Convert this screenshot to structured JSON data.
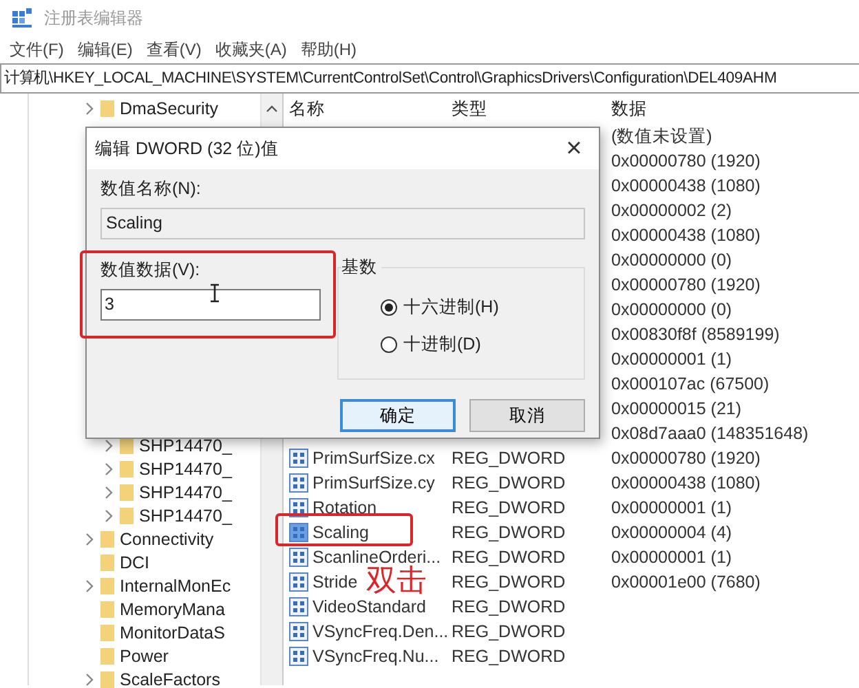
{
  "window": {
    "title": "注册表编辑器"
  },
  "menu": [
    "文件(F)",
    "编辑(E)",
    "查看(V)",
    "收藏夹(A)",
    "帮助(H)"
  ],
  "address": "计算机\\HKEY_LOCAL_MACHINE\\SYSTEM\\CurrentControlSet\\Control\\GraphicsDrivers\\Configuration\\DEL409AHM",
  "tree": {
    "items": [
      {
        "label": "DmaSecurity",
        "expandable": true
      },
      {
        "children": [
          {
            "label": "SHP14470_",
            "expandable": true
          },
          {
            "label": "SHP14470_",
            "expandable": true
          },
          {
            "label": "SHP14470_",
            "expandable": true
          },
          {
            "label": "SHP14470_",
            "expandable": true
          }
        ]
      },
      {
        "label": "Connectivity",
        "expandable": true
      },
      {
        "label": "DCI",
        "expandable": false
      },
      {
        "label": "InternalMonEc",
        "expandable": true
      },
      {
        "label": "MemoryMana",
        "expandable": false
      },
      {
        "label": "MonitorDataS",
        "expandable": false
      },
      {
        "label": "Power",
        "expandable": false
      },
      {
        "label": "ScaleFactors",
        "expandable": true
      }
    ]
  },
  "list": {
    "columns": [
      "名称",
      "类型",
      "数据"
    ],
    "rows": [
      {
        "data": "(数值未设置)"
      },
      {
        "data": "0x00000780 (1920)"
      },
      {
        "data": "0x00000438 (1080)"
      },
      {
        "data": "0x00000002 (2)"
      },
      {
        "data": "0x00000438 (1080)"
      },
      {
        "data": "0x00000000 (0)"
      },
      {
        "data": "0x00000780 (1920)"
      },
      {
        "data": "0x00000000 (0)"
      },
      {
        "data": "0x00830f8f (8589199)"
      },
      {
        "data": "0x00000001 (1)"
      },
      {
        "data": "0x000107ac (67500)"
      },
      {
        "data": "0x00000015 (21)"
      },
      {
        "data": "0x08d7aaa0 (148351648)"
      },
      {
        "name": "PrimSurfSize.cx",
        "type": "REG_DWORD",
        "data": "0x00000780 (1920)"
      },
      {
        "name": "PrimSurfSize.cy",
        "type": "REG_DWORD",
        "data": "0x00000438 (1080)"
      },
      {
        "name": "Rotation",
        "type": "REG_DWORD",
        "data": "0x00000001 (1)"
      },
      {
        "name": "Scaling",
        "type": "REG_DWORD",
        "data": "0x00000004 (4)",
        "marked": true
      },
      {
        "name": "ScanlineOrderi...",
        "type": "REG_DWORD",
        "data": "0x00000001 (1)"
      },
      {
        "name": "Stride",
        "type": "REG_DWORD",
        "data": "0x00001e00 (7680)"
      },
      {
        "name": "VideoStandard",
        "type": "REG_DWORD"
      },
      {
        "name": "VSyncFreq.Den...",
        "type": "REG_DWORD"
      },
      {
        "name": "VSyncFreq.Nu...",
        "type": "REG_DWORD"
      }
    ]
  },
  "dialog": {
    "title": "编辑 DWORD (32 位)值",
    "close": "×",
    "name_label": "数值名称(N):",
    "name_value": "Scaling",
    "data_label": "数值数据(V):",
    "data_value": "3",
    "base_label": "基数",
    "radios": [
      {
        "label": "十六进制(H)",
        "selected": true
      },
      {
        "label": "十进制(D)",
        "selected": false
      }
    ],
    "buttons": [
      {
        "label": "确定",
        "default": true
      },
      {
        "label": "取消",
        "default": false
      }
    ]
  },
  "annotation": {
    "text": "双击"
  }
}
